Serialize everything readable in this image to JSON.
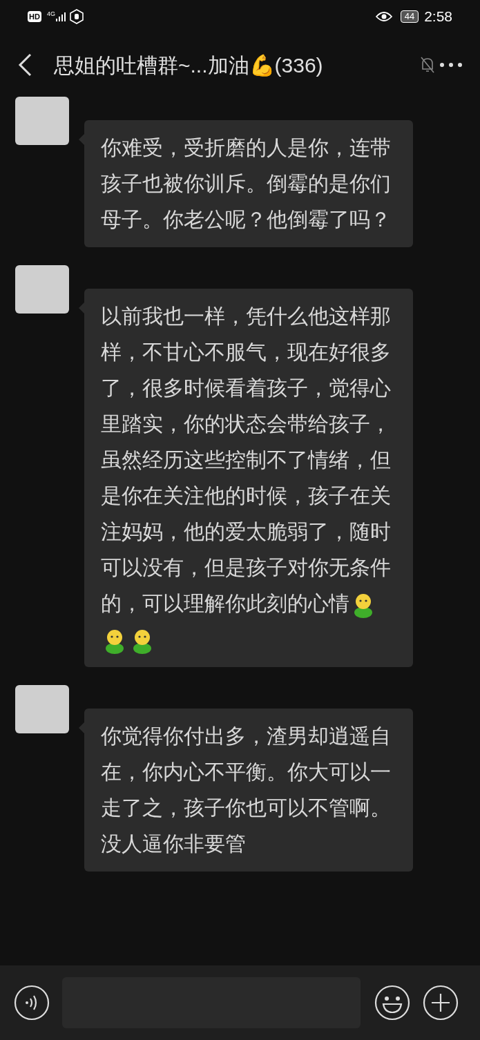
{
  "status_bar": {
    "hd": "HD",
    "network": "4G",
    "battery": "44",
    "time": "2:58"
  },
  "header": {
    "title": "思姐的吐槽群~...加油💪(336)",
    "muted": true
  },
  "messages": [
    {
      "text": "你难受，受折磨的人是你，连带孩子也被你训斥。倒霉的是你们母子。你老公呢？他倒霉了吗？"
    },
    {
      "text": "以前我也一样，凭什么他这样那样，不甘心不服气，现在好很多了，很多时候看着孩子，觉得心里踏实，你的状态会带给孩子，虽然经历这些控制不了情绪，但是你在关注他的时候，孩子在关注妈妈，他的爱太脆弱了，随时可以没有，但是孩子对你无条件的，可以理解你此刻的心情",
      "emojis": [
        {
          "kind": "figure"
        },
        {
          "kind": "figure"
        },
        {
          "kind": "figure"
        }
      ]
    },
    {
      "text": "你觉得你付出多，渣男却逍遥自在，你内心不平衡。你大可以一走了之，孩子你也可以不管啊。没人逼你非要管"
    }
  ]
}
